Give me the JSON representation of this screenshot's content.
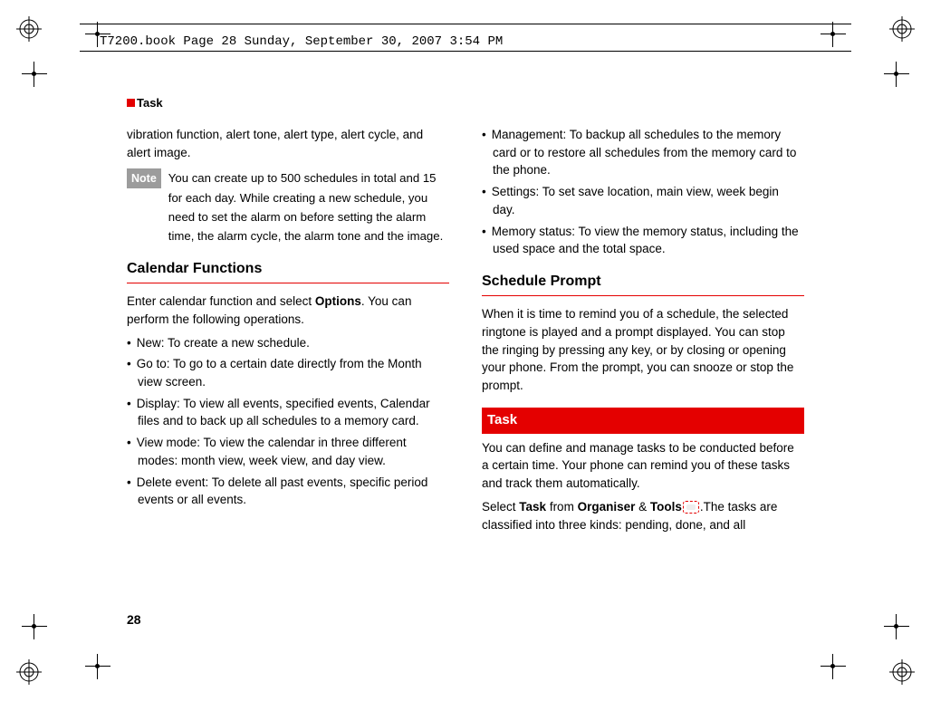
{
  "page": {
    "header_line": "T7200.book  Page 28  Sunday, September 30, 2007  3:54 PM",
    "running_head": "Task",
    "page_number": "28"
  },
  "left": {
    "intro": "vibration function, alert tone, alert type, alert cycle, and alert image.",
    "note_label": "Note",
    "note_text": "You can create up to 500 schedules in total and 15 for each day. While creating a new schedule, you need to set the alarm on before setting the alarm time, the alarm cycle, the alarm tone and the image.",
    "h_calendar": "Calendar Functions",
    "calendar_intro_a": "Enter calendar function and select ",
    "calendar_intro_bold": "Options",
    "calendar_intro_b": ". You can perform the following operations.",
    "bullets": [
      "New: To create a new schedule.",
      "Go to: To go to a certain date directly from the Month view screen.",
      "Display: To view all events, specified events, Calendar files and to back up all schedules to a memory card.",
      "View mode: To view the calendar in three different modes: month view, week view, and day view.",
      "Delete event: To delete all past events, specific period events or all events."
    ]
  },
  "right": {
    "bullets_top": [
      "Management: To backup all schedules to the memory card or to restore all schedules from the memory card to the phone.",
      "Settings: To set save location, main view, week begin day.",
      "Memory status: To view the memory status, including the used space and the total space."
    ],
    "h_schedule": "Schedule Prompt",
    "schedule_para": "When it is time to remind you of a schedule, the selected ringtone is played and a prompt displayed. You can stop the ringing by pressing any key, or by closing or opening your phone. From the prompt, you can   snooze or stop the prompt.",
    "task_bar": "Task",
    "task_intro": "You can define and manage tasks to be conducted before a certain time. Your phone can remind you of these tasks and track them automatically.",
    "task_select_a": "Select ",
    "task_select_b1": "Task",
    "task_select_c": " from ",
    "task_select_b2": "Organiser",
    "task_select_d": " & ",
    "task_select_b3": "Tools",
    "task_select_e": ".The tasks are classified into three kinds: pending, done, and all"
  }
}
